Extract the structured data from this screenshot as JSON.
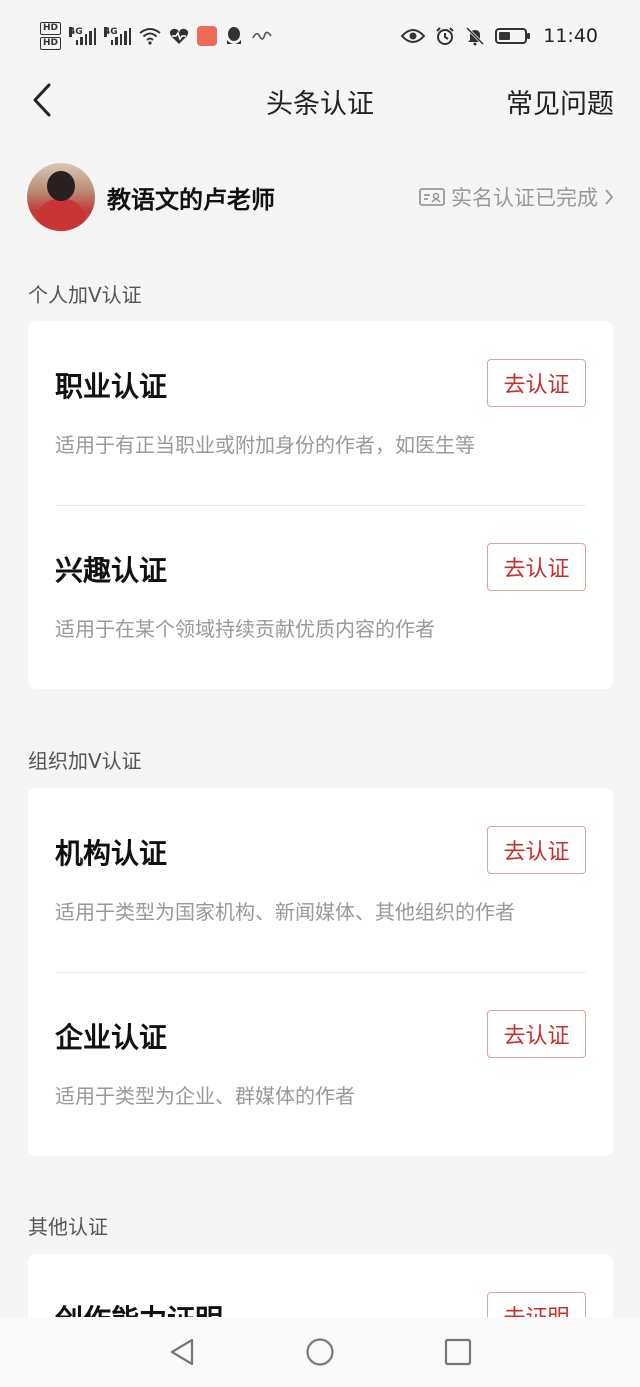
{
  "status_bar": {
    "hd_badges": [
      "HD",
      "HD"
    ],
    "network_labels": [
      "4G",
      "4G"
    ],
    "time": "11:40",
    "battery_level": 0.45
  },
  "nav": {
    "title": "头条认证",
    "faq": "常见问题"
  },
  "profile": {
    "name": "教语文的卢老师",
    "verify_status": "实名认证已完成"
  },
  "sections": [
    {
      "label": "个人加V认证",
      "items": [
        {
          "title": "职业认证",
          "desc": "适用于有正当职业或附加身份的作者，如医生等",
          "button": "去认证"
        },
        {
          "title": "兴趣认证",
          "desc": "适用于在某个领域持续贡献优质内容的作者",
          "button": "去认证"
        }
      ]
    },
    {
      "label": "组织加V认证",
      "items": [
        {
          "title": "机构认证",
          "desc": "适用于类型为国家机构、新闻媒体、其他组织的作者",
          "button": "去认证"
        },
        {
          "title": "企业认证",
          "desc": "适用于类型为企业、群媒体的作者",
          "button": "去认证"
        }
      ]
    },
    {
      "label": "其他认证",
      "items": [
        {
          "title": "创作能力证明",
          "button": "去证明"
        }
      ]
    }
  ],
  "colors": {
    "accent": "#c9302c",
    "background": "#f5f5f5"
  }
}
